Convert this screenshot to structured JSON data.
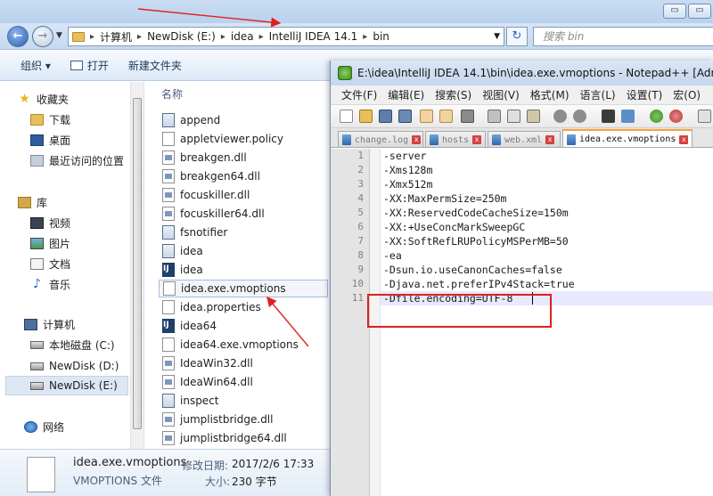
{
  "explorer": {
    "address": {
      "crumbs": [
        "计算机",
        "NewDisk (E:)",
        "idea",
        "IntelliJ IDEA 14.1",
        "bin"
      ]
    },
    "search_placeholder": "搜索 bin",
    "toolbar": {
      "organize": "组织 ▾",
      "open": "打开",
      "new_folder": "新建文件夹"
    },
    "nav": {
      "favorites": "收藏夹",
      "downloads": "下载",
      "desktop": "桌面",
      "recent": "最近访问的位置",
      "libraries": "库",
      "videos": "视频",
      "pictures": "图片",
      "documents": "文档",
      "music": "音乐",
      "computer": "计算机",
      "local_disk": "本地磁盘 (C:)",
      "newdisk_d": "NewDisk (D:)",
      "newdisk_e": "NewDisk (E:)",
      "network": "网络"
    },
    "column_name": "名称",
    "files": [
      {
        "name": "append",
        "kind": "exe"
      },
      {
        "name": "appletviewer.policy",
        "kind": "file"
      },
      {
        "name": "breakgen.dll",
        "kind": "dll"
      },
      {
        "name": "breakgen64.dll",
        "kind": "dll"
      },
      {
        "name": "focuskiller.dll",
        "kind": "dll"
      },
      {
        "name": "focuskiller64.dll",
        "kind": "dll"
      },
      {
        "name": "fsnotifier",
        "kind": "exe"
      },
      {
        "name": "idea",
        "kind": "exe"
      },
      {
        "name": "idea",
        "kind": "ij"
      },
      {
        "name": "idea.exe.vmoptions",
        "kind": "file",
        "selected": true
      },
      {
        "name": "idea.properties",
        "kind": "file"
      },
      {
        "name": "idea64",
        "kind": "ij"
      },
      {
        "name": "idea64.exe.vmoptions",
        "kind": "file"
      },
      {
        "name": "IdeaWin32.dll",
        "kind": "dll"
      },
      {
        "name": "IdeaWin64.dll",
        "kind": "dll"
      },
      {
        "name": "inspect",
        "kind": "exe"
      },
      {
        "name": "jumplistbridge.dll",
        "kind": "dll"
      },
      {
        "name": "jumplistbridge64.dll",
        "kind": "dll"
      }
    ],
    "details": {
      "name": "idea.exe.vmoptions",
      "type": "VMOPTIONS 文件",
      "modified_label": "修改日期:",
      "modified_value": "2017/2/6 17:33",
      "size_label": "大小:",
      "size_value": "230 字节"
    }
  },
  "notepad": {
    "title": "E:\\idea\\IntelliJ IDEA 14.1\\bin\\idea.exe.vmoptions - Notepad++ [Admi",
    "menu": [
      "文件(F)",
      "编辑(E)",
      "搜索(S)",
      "视图(V)",
      "格式(M)",
      "语言(L)",
      "设置(T)",
      "宏(O)"
    ],
    "tabs": [
      "change.log",
      "hosts",
      "web.xml",
      "idea.exe.vmoptions"
    ],
    "active_tab": 3,
    "lines": [
      "-server",
      "-Xms128m",
      "-Xmx512m",
      "-XX:MaxPermSize=250m",
      "-XX:ReservedCodeCacheSize=150m",
      "-XX:+UseConcMarkSweepGC",
      "-XX:SoftRefLRUPolicyMSPerMB=50",
      "-ea",
      "-Dsun.io.useCanonCaches=false",
      "-Djava.net.preferIPv4Stack=true",
      "-Dfile.encoding=UTF-8"
    ],
    "line_numbers": [
      "1",
      "2",
      "3",
      "4",
      "5",
      "6",
      "7",
      "8",
      "9",
      "10",
      "11"
    ]
  },
  "colors": {
    "annotation": "#e02020",
    "accent": "#2c5fb3"
  }
}
